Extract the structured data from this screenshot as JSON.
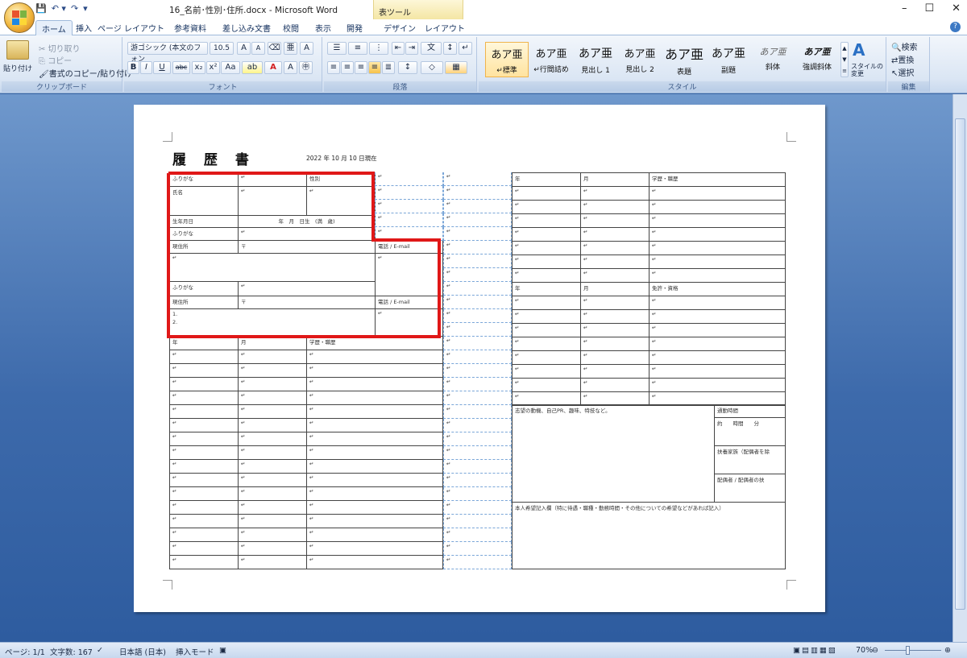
{
  "titlebar": {
    "document_title": "16_名前･性別･住所.docx - Microsoft Word",
    "context_tab_title": "表ツール",
    "quick_access": [
      "💾",
      "↶ ▾",
      "↷",
      "▾"
    ]
  },
  "tabs": {
    "home": "ホーム",
    "insert": "挿入",
    "page_layout": "ページ レイアウト",
    "references": "参考資料",
    "mailings": "差し込み文書",
    "review": "校閲",
    "view": "表示",
    "developer": "開発",
    "design": "デザイン",
    "layout": "レイアウト"
  },
  "ribbon": {
    "clipboard": {
      "label": "クリップボード",
      "paste": "貼り付け",
      "cut": "切り取り",
      "copy": "コピー",
      "format_painter": "書式のコピー/貼り付け"
    },
    "font": {
      "label": "フォント",
      "font_name": "游ゴシック (本文のフォン",
      "font_size": "10.5"
    },
    "paragraph": {
      "label": "段落"
    },
    "styles": {
      "label": "スタイル",
      "items": [
        {
          "sample": "あア亜",
          "name": "↵標準"
        },
        {
          "sample": "あア亜",
          "name": "↵行間詰め"
        },
        {
          "sample": "あア亜",
          "name": "見出し 1"
        },
        {
          "sample": "あア亜",
          "name": "見出し 2"
        },
        {
          "sample": "あア亜",
          "name": "表題"
        },
        {
          "sample": "あア亜",
          "name": "副題"
        },
        {
          "sample": "あア亜",
          "name": "斜体"
        },
        {
          "sample": "あア亜",
          "name": "強調斜体"
        }
      ],
      "change_styles": "スタイルの変更"
    },
    "editing": {
      "label": "編集",
      "find": "検索",
      "replace": "置換",
      "select": "選択"
    }
  },
  "document": {
    "heading": "履 歴 書",
    "date_line": "2022 年 10 月 10 日現在",
    "cells": {
      "furigana": "ふりがな",
      "gender": "性別",
      "name": "氏名",
      "birthdate": "生年月日",
      "birth_fields": "年　月　日生　(満　歳)",
      "address": "現住所",
      "postal": "〒",
      "phone_email": "電話 / E-mail",
      "contact_1": "1.",
      "contact_2": "2.",
      "year": "年",
      "month": "月",
      "history": "学歴・職歴",
      "license": "免許・資格",
      "motivation": "志望の動機、自己PR、趣味、特技など。",
      "commute": "通勤時間",
      "commute_value": "約　　時間　　分",
      "dependents": "扶養家族（配偶者を除",
      "spouse": "配偶者 / 配偶者の扶",
      "wishes": "本人希望記入欄（特に待遇・職種・勤務時間・その他についての希望などがあれば記入）",
      "mark": "↵"
    }
  },
  "statusbar": {
    "page": "ページ: 1/1",
    "words": "文字数: 167",
    "language": "日本語 (日本)",
    "mode": "挿入モード",
    "zoom": "70%"
  },
  "colors": {
    "highlight": "#e01818",
    "ribbon_bg": "#dbe6f4",
    "workspace": "#3d6aab"
  }
}
